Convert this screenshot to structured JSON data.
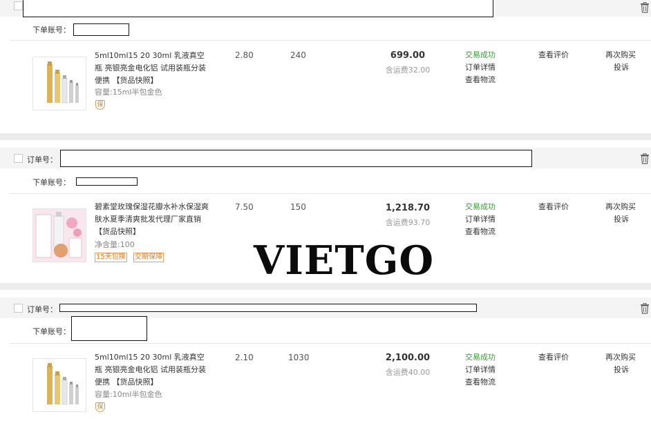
{
  "common": {
    "order_no_label": "订单号：",
    "account_label": "下单账号：",
    "badge_bao": "保"
  },
  "orders": [
    {
      "product_title": "5ml10ml15 20 30ml 乳液真空瓶 亮银亮金电化铝 试用装瓶分装便携 【货品快照】",
      "sku": "容量:15ml半包金色",
      "unit_price": "2.80",
      "quantity": "240",
      "total": "699.00",
      "shipping": "含运费32.00",
      "status": "交易成功",
      "detail_link": "订单详情",
      "logistics_link": "查看物流",
      "review_link": "查看评价",
      "rebuy_link": "再次购买",
      "complain_link": "投诉"
    },
    {
      "product_title": "碧素堂玫瑰保湿花瓣水补水保湿爽肤水夏季清爽批发代理厂家直销 【货品快照】",
      "sku": "净含量:100",
      "unit_price": "7.50",
      "quantity": "150",
      "total": "1,218.70",
      "shipping": "含运费93.70",
      "status": "交易成功",
      "detail_link": "订单详情",
      "logistics_link": "查看物流",
      "review_link": "查看评价",
      "rebuy_link": "再次购买",
      "complain_link": "投诉",
      "badges": [
        "15天包换",
        "交期保障"
      ]
    },
    {
      "product_title": "5ml10ml15 20 30ml 乳液真空瓶 亮银亮金电化铝 试用装瓶分装便携 【货品快照】",
      "sku": "容量:10ml半包金色",
      "unit_price": "2.10",
      "quantity": "1030",
      "total": "2,100.00",
      "shipping": "含运费40.00",
      "status": "交易成功",
      "detail_link": "订单详情",
      "logistics_link": "查看物流",
      "review_link": "查看评价",
      "rebuy_link": "再次购买",
      "complain_link": "投诉"
    }
  ],
  "watermark": "VIETGO"
}
